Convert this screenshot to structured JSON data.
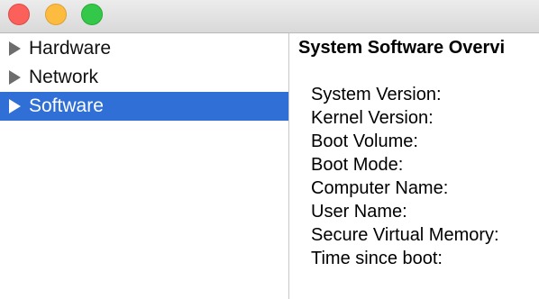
{
  "sidebar": {
    "items": [
      {
        "label": "Hardware",
        "selected": false
      },
      {
        "label": "Network",
        "selected": false
      },
      {
        "label": "Software",
        "selected": true
      }
    ]
  },
  "content": {
    "title": "System Software Overvi",
    "fields": [
      {
        "label": "System Version:"
      },
      {
        "label": "Kernel Version:"
      },
      {
        "label": "Boot Volume:"
      },
      {
        "label": "Boot Mode:"
      },
      {
        "label": "Computer Name:"
      },
      {
        "label": "User Name:"
      },
      {
        "label": "Secure Virtual Memory:"
      },
      {
        "label": "Time since boot:"
      }
    ]
  },
  "colors": {
    "selection": "#2f6fd6",
    "close": "#fc605b",
    "minimize": "#fdbc40",
    "zoom": "#34c84a"
  }
}
